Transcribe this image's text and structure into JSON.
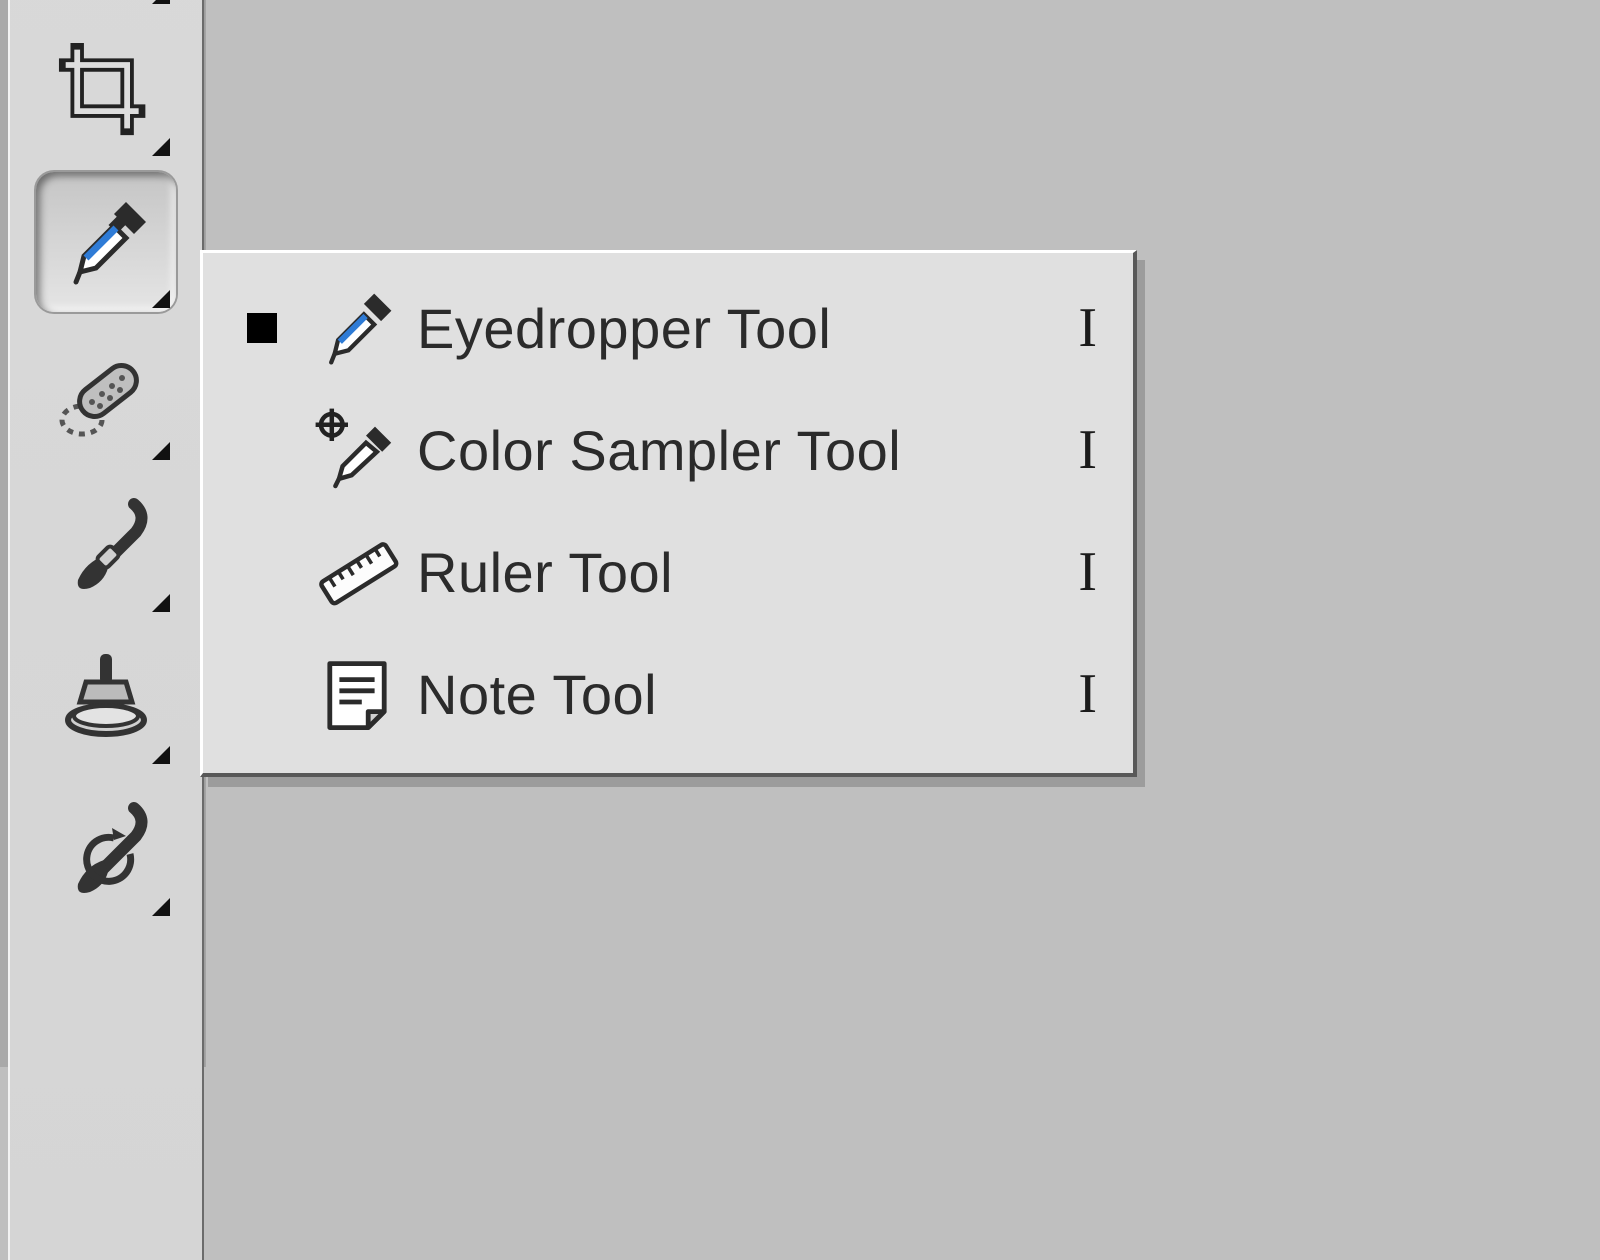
{
  "toolbox": {
    "tools": [
      {
        "id": "lasso",
        "name": "lasso-tool-icon",
        "has_flyout": true,
        "active": false
      },
      {
        "id": "crop",
        "name": "crop-tool-icon",
        "has_flyout": true,
        "active": false
      },
      {
        "id": "eyedropper",
        "name": "eyedropper-tool-icon",
        "has_flyout": true,
        "active": true
      },
      {
        "id": "healing-brush",
        "name": "healing-brush-tool-icon",
        "has_flyout": true,
        "active": false
      },
      {
        "id": "brush",
        "name": "brush-tool-icon",
        "has_flyout": true,
        "active": false
      },
      {
        "id": "clone-stamp",
        "name": "clone-stamp-tool-icon",
        "has_flyout": true,
        "active": false
      },
      {
        "id": "history-brush",
        "name": "history-brush-tool-icon",
        "has_flyout": true,
        "active": false
      }
    ]
  },
  "flyout": {
    "items": [
      {
        "label": "Eyedropper Tool",
        "shortcut": "I",
        "selected": true,
        "icon": "eyedropper-icon"
      },
      {
        "label": "Color Sampler Tool",
        "shortcut": "I",
        "selected": false,
        "icon": "color-sampler-icon"
      },
      {
        "label": "Ruler Tool",
        "shortcut": "I",
        "selected": false,
        "icon": "ruler-icon"
      },
      {
        "label": "Note Tool",
        "shortcut": "I",
        "selected": false,
        "icon": "note-icon"
      }
    ]
  }
}
